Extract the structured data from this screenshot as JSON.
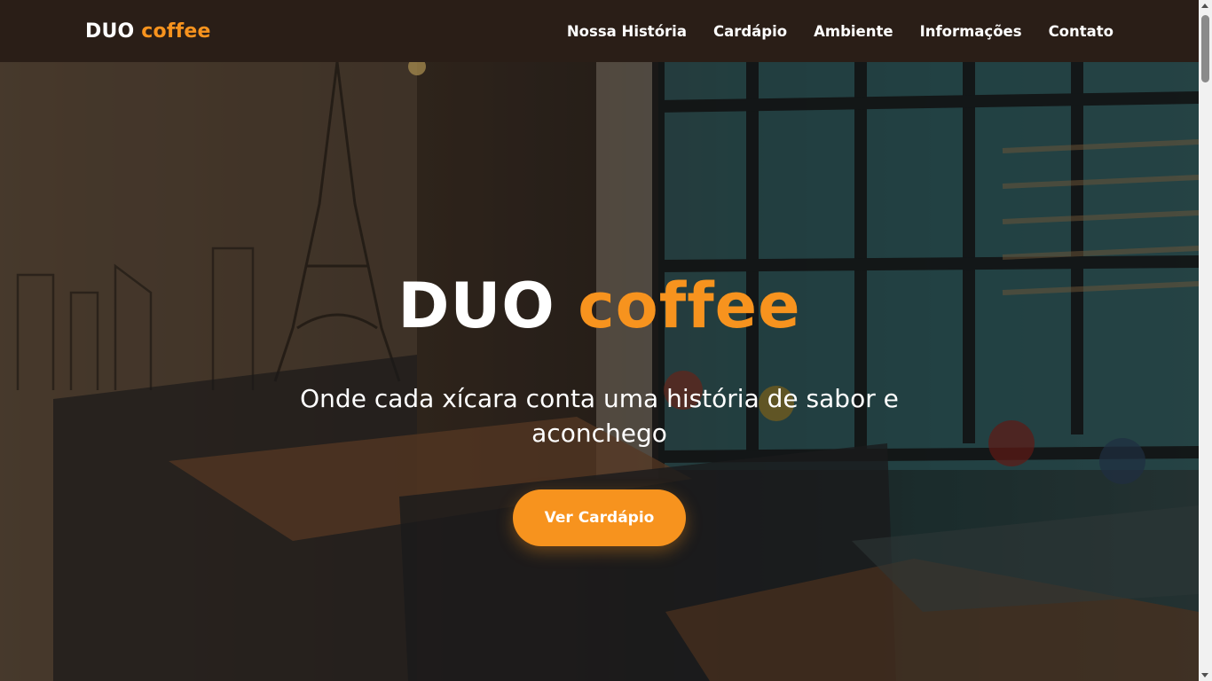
{
  "navbar": {
    "brand_main": "DUO",
    "brand_accent": "coffee",
    "links": [
      "Nossa História",
      "Cardápio",
      "Ambiente",
      "Informações",
      "Contato"
    ]
  },
  "hero": {
    "title_main": "DUO",
    "title_accent": "coffee",
    "subtitle": "Onde cada xícara conta uma história de sabor e aconchego",
    "cta_label": "Ver Cardápio"
  },
  "colors": {
    "accent": "#f7931e",
    "navbar_bg": "#2a1e17",
    "text_light": "#ffffff"
  },
  "icons": {
    "scroll_up": "triangle-up-icon",
    "scroll_down": "triangle-down-icon"
  }
}
